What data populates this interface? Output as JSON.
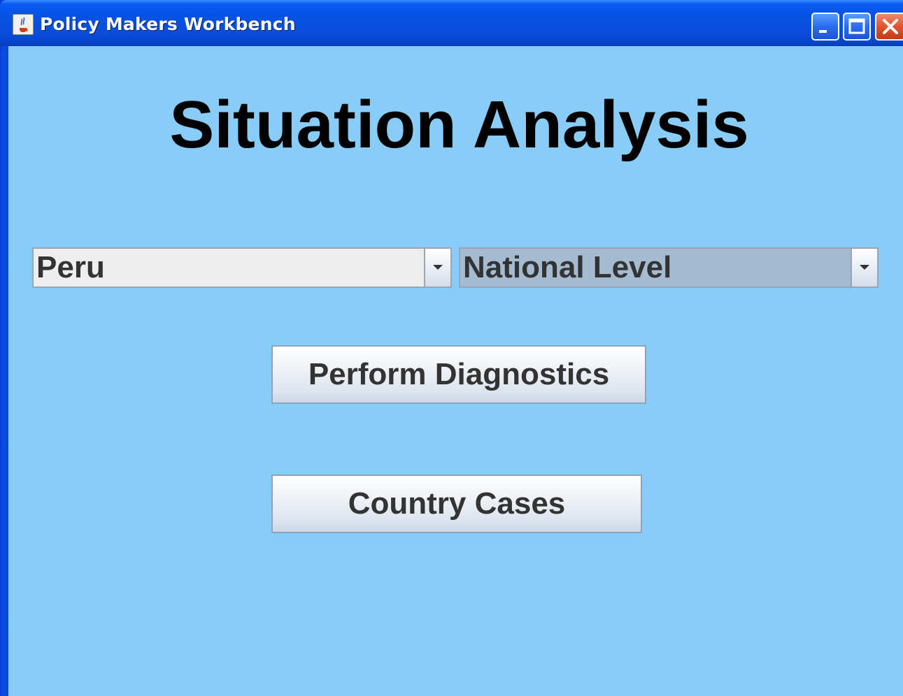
{
  "window": {
    "title": "Policy Makers Workbench",
    "app_icon": "java-coffee-cup-icon",
    "controls": {
      "minimize": "minimize-icon",
      "maximize": "maximize-icon",
      "close": "close-icon"
    }
  },
  "main": {
    "heading": "Situation Analysis",
    "country_select": {
      "selected": "Peru"
    },
    "level_select": {
      "selected": "National Level"
    },
    "buttons": {
      "diagnostics": "Perform Diagnostics",
      "country_cases": "Country Cases"
    }
  },
  "colors": {
    "background": "#87cdf8",
    "titlebar": "#0553e6",
    "heading_text": "#000000",
    "level_select_bg": "#a4bbd2",
    "close_button": "#e0532e"
  }
}
